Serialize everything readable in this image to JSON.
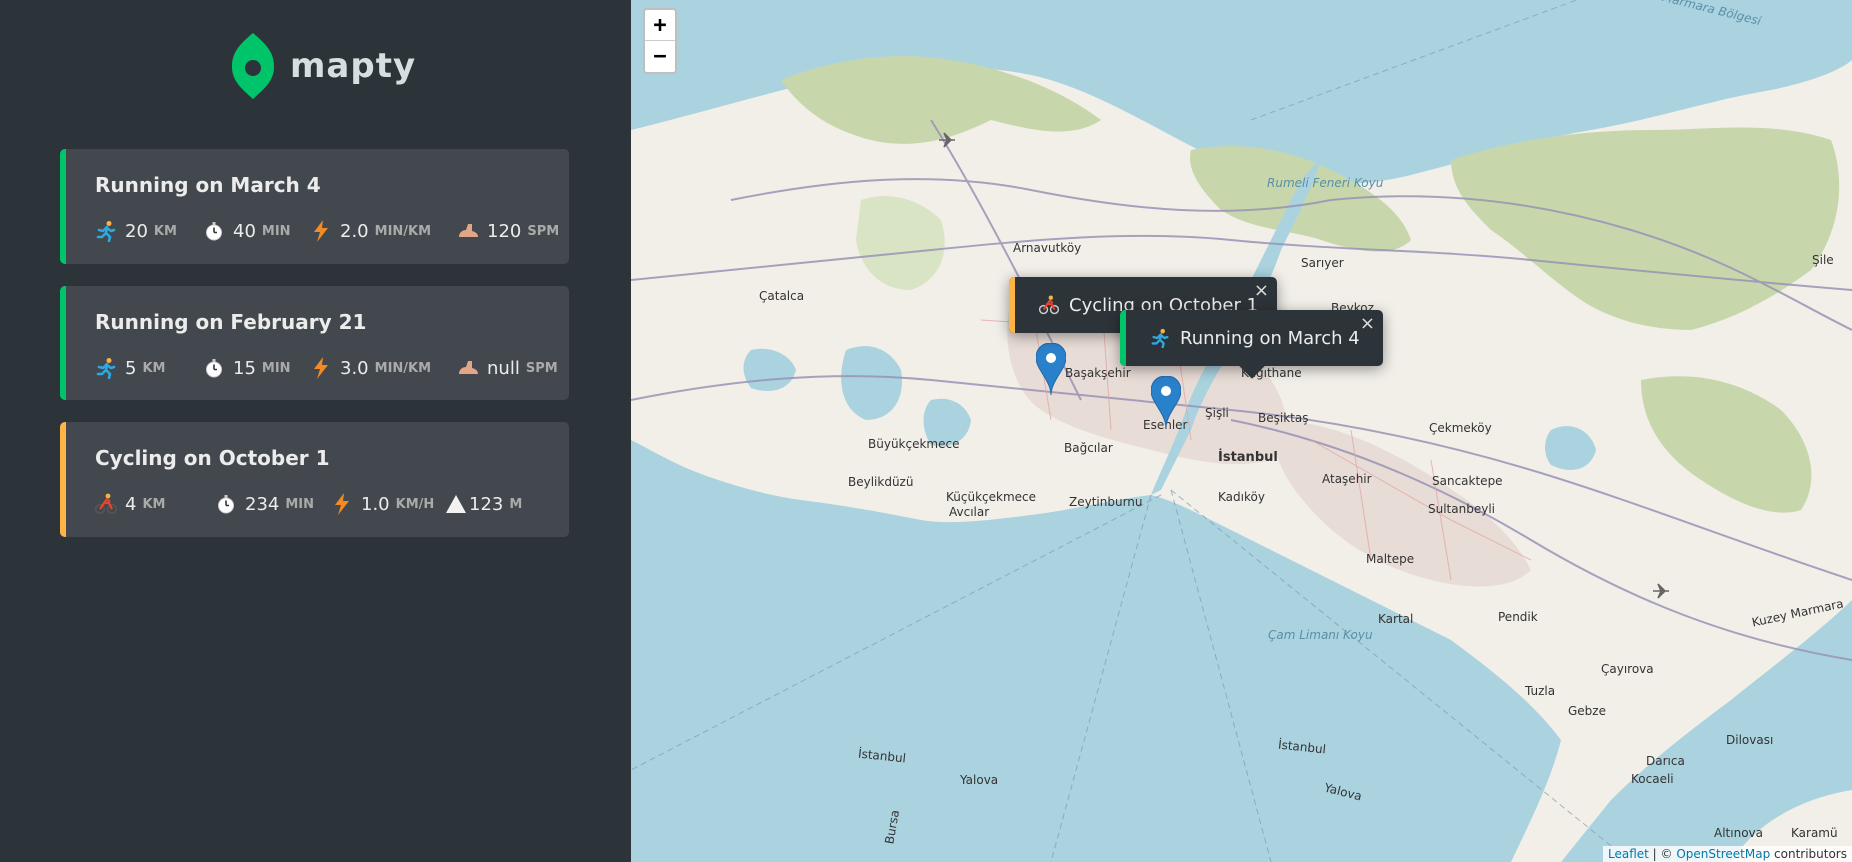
{
  "app": {
    "name": "mapty"
  },
  "colors": {
    "running": "#00c46a",
    "cycling": "#ffb545",
    "sidebar_bg": "#2d3439",
    "card_bg": "#42484d",
    "marker": "#2a81cb"
  },
  "workouts": [
    {
      "type": "running",
      "title": "Running on March 4",
      "details": [
        {
          "icon": "runner-icon",
          "value": "20",
          "unit": "km"
        },
        {
          "icon": "stopwatch-icon",
          "value": "40",
          "unit": "min"
        },
        {
          "icon": "lightning-icon",
          "value": "2.0",
          "unit": "min/km"
        },
        {
          "icon": "footprint-icon",
          "value": "120",
          "unit": "spm"
        }
      ]
    },
    {
      "type": "running",
      "title": "Running on February 21",
      "details": [
        {
          "icon": "runner-icon",
          "value": "5",
          "unit": "km"
        },
        {
          "icon": "stopwatch-icon",
          "value": "15",
          "unit": "min"
        },
        {
          "icon": "lightning-icon",
          "value": "3.0",
          "unit": "min/km"
        },
        {
          "icon": "footprint-icon",
          "value": "null",
          "unit": "spm"
        }
      ]
    },
    {
      "type": "cycling",
      "title": "Cycling on October 1",
      "details": [
        {
          "icon": "cyclist-icon",
          "value": "4",
          "unit": "km"
        },
        {
          "icon": "stopwatch-icon",
          "value": "234",
          "unit": "min"
        },
        {
          "icon": "lightning-icon",
          "value": "1.0",
          "unit": "km/h"
        },
        {
          "icon": "mountain-icon",
          "value": "123",
          "unit": "m"
        }
      ]
    }
  ],
  "map": {
    "zoom_in_label": "+",
    "zoom_out_label": "−",
    "popups": [
      {
        "type": "cycling",
        "text": "Cycling on October 1",
        "close": "×"
      },
      {
        "type": "running",
        "text": "Running on March 4",
        "close": "×"
      }
    ],
    "attribution": {
      "leaflet": "Leaflet",
      "sep": " | © ",
      "osm": "OpenStreetMap",
      "suffix": " contributors"
    },
    "labels": [
      {
        "text": "Marmara Bölgesi",
        "cls": "sea"
      },
      {
        "text": "Rumeli Feneri Koyu",
        "cls": "sea"
      },
      {
        "text": "Arnavutköy",
        "cls": ""
      },
      {
        "text": "Sarıyer",
        "cls": ""
      },
      {
        "text": "Şile",
        "cls": ""
      },
      {
        "text": "Çatalca",
        "cls": ""
      },
      {
        "text": "Başakşehir",
        "cls": ""
      },
      {
        "text": "Kağıthane",
        "cls": ""
      },
      {
        "text": "Beykoz",
        "cls": ""
      },
      {
        "text": "Şişli",
        "cls": ""
      },
      {
        "text": "Beşiktaş",
        "cls": ""
      },
      {
        "text": "Esenler",
        "cls": ""
      },
      {
        "text": "Çekmeköy",
        "cls": ""
      },
      {
        "text": "Büyükçekmece",
        "cls": ""
      },
      {
        "text": "Bağcılar",
        "cls": ""
      },
      {
        "text": "İstanbul",
        "cls": "b"
      },
      {
        "text": "Beylikdüzü",
        "cls": ""
      },
      {
        "text": "Küçükçekmece",
        "cls": ""
      },
      {
        "text": "Avcılar",
        "cls": ""
      },
      {
        "text": "Zeytinburnu",
        "cls": ""
      },
      {
        "text": "Kadıköy",
        "cls": ""
      },
      {
        "text": "Ataşehir",
        "cls": ""
      },
      {
        "text": "Sancaktepe",
        "cls": ""
      },
      {
        "text": "Sultanbeyli",
        "cls": ""
      },
      {
        "text": "Maltepe",
        "cls": ""
      },
      {
        "text": "Kartal",
        "cls": ""
      },
      {
        "text": "Pendik",
        "cls": ""
      },
      {
        "text": "Çam Limanı Koyu",
        "cls": "sea"
      },
      {
        "text": "Tuzla",
        "cls": ""
      },
      {
        "text": "Çayırova",
        "cls": ""
      },
      {
        "text": "Gebze",
        "cls": ""
      },
      {
        "text": "Kuzey Marmara",
        "cls": ""
      },
      {
        "text": "Dilovası",
        "cls": ""
      },
      {
        "text": "Darıca",
        "cls": ""
      },
      {
        "text": "Kocaeli",
        "cls": ""
      },
      {
        "text": "İstanbul",
        "cls": ""
      },
      {
        "text": "İstanbul",
        "cls": ""
      },
      {
        "text": "Yalova",
        "cls": ""
      },
      {
        "text": "Yalova",
        "cls": ""
      },
      {
        "text": "Bursa",
        "cls": ""
      },
      {
        "text": "Altınova",
        "cls": ""
      },
      {
        "text": "Karamü",
        "cls": ""
      }
    ]
  }
}
